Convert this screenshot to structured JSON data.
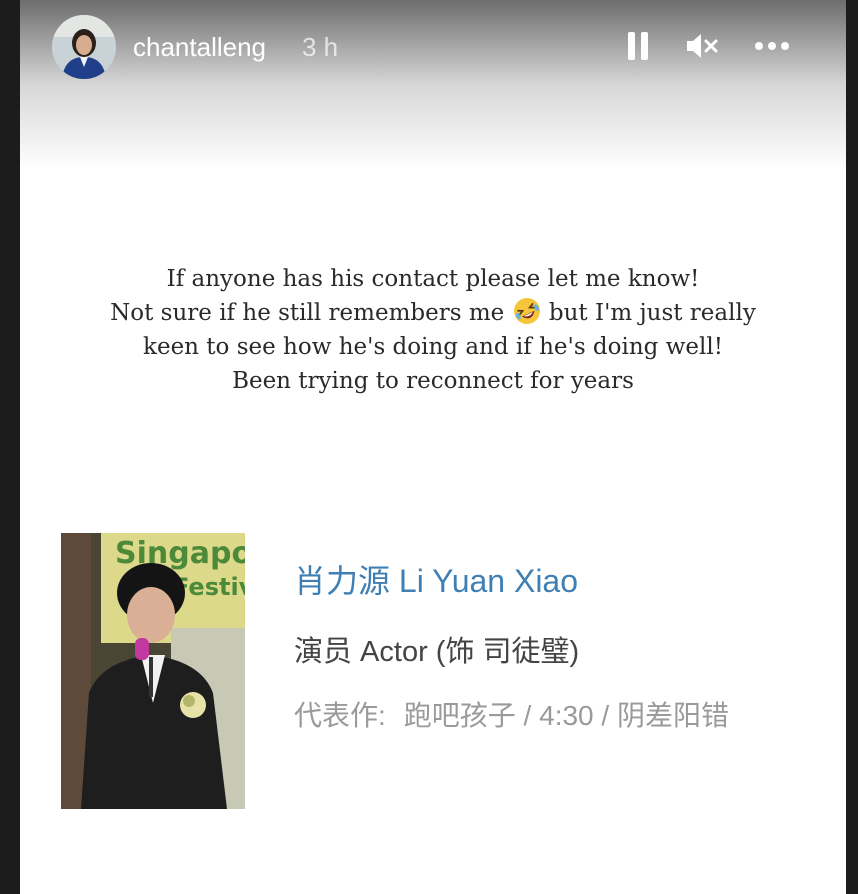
{
  "header": {
    "username": "chantalleng",
    "timestamp": "3 h",
    "controls": {
      "pause": "pause-icon",
      "mute": "muted-speaker-icon",
      "more": "more-options-icon"
    }
  },
  "caption": {
    "line1": "If anyone has his contact please let me know!",
    "line2_before_emoji": "Not sure if he still remembers me",
    "emoji": "rolling-on-floor-laughing-emoji",
    "line2_after_emoji": "but I'm just really",
    "line3": "keen to see how he's doing and if he's doing well!",
    "line4": "Been trying to reconnect for years"
  },
  "profile_card": {
    "photo_sign_text_1": "Singapo",
    "photo_sign_text_2": "Festiv",
    "name": "肖力源 Li Yuan Xiao",
    "role": "演员 Actor (饰 司徒璧)",
    "works_label": "代表作:",
    "works": "跑吧孩子 / 4:30 / 阴差阳错"
  },
  "colors": {
    "name_link": "#3f7fb3",
    "role_text": "#444444",
    "works_text": "#9a9a9a",
    "frame": "#1c1c1c"
  }
}
